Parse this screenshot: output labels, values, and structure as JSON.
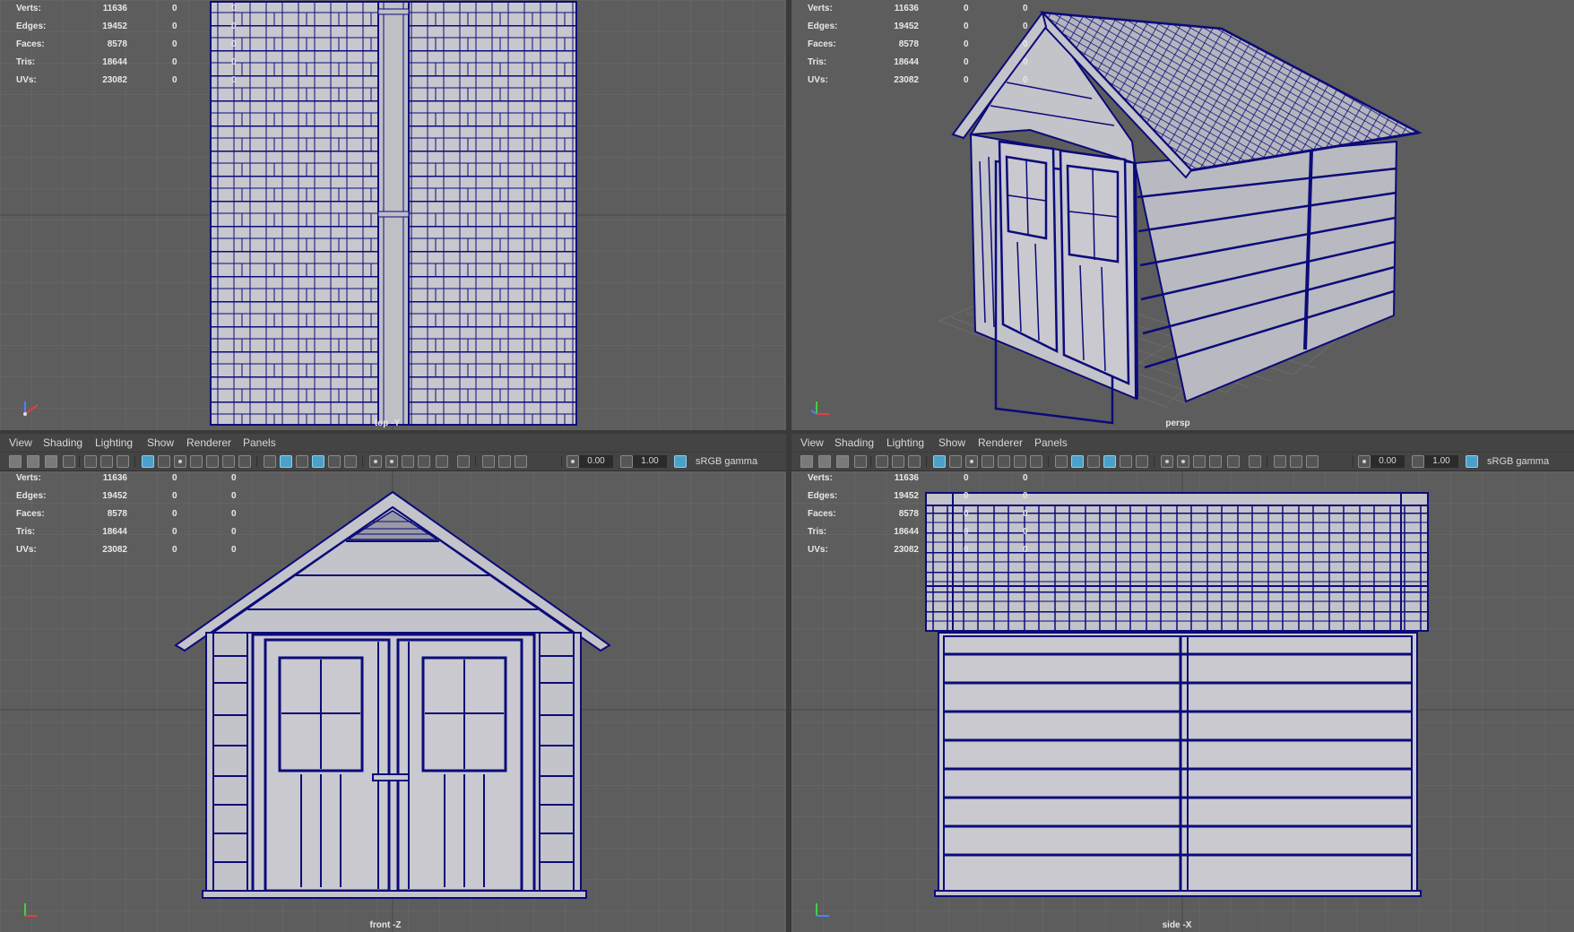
{
  "stats": {
    "rows": [
      {
        "label": "Verts:",
        "value": "11636",
        "c2": "0",
        "c3": "0"
      },
      {
        "label": "Edges:",
        "value": "19452",
        "c2": "0",
        "c3": "0"
      },
      {
        "label": "Faces:",
        "value": "8578",
        "c2": "0",
        "c3": "0"
      },
      {
        "label": "Tris:",
        "value": "18644",
        "c2": "0",
        "c3": "0"
      },
      {
        "label": "UVs:",
        "value": "23082",
        "c2": "0",
        "c3": "0"
      }
    ]
  },
  "viewports": {
    "top": {
      "camera": "top -Y"
    },
    "persp": {
      "camera": "persp"
    },
    "front": {
      "camera": "front -Z"
    },
    "side": {
      "camera": "side -X"
    }
  },
  "panel_menu": {
    "view": "View",
    "shading": "Shading",
    "lighting": "Lighting",
    "show": "Show",
    "renderer": "Renderer",
    "panels": "Panels"
  },
  "panel_toolbar": {
    "exposure": "0.00",
    "gamma": "1.00",
    "color_space": "sRGB gamma"
  },
  "colors": {
    "viewport_bg": "#5d5d5d",
    "grid": "#6a6a6a",
    "wireframe": "#0b0b7a",
    "surface": "#c9c9cf",
    "active_icon": "#4ba1c7"
  },
  "icons": [
    "camera-icon",
    "grid-icon",
    "wireframe-icon",
    "smooth-shade-icon",
    "isolate-icon",
    "exposure-icon",
    "gamma-icon",
    "color-management-icon"
  ]
}
